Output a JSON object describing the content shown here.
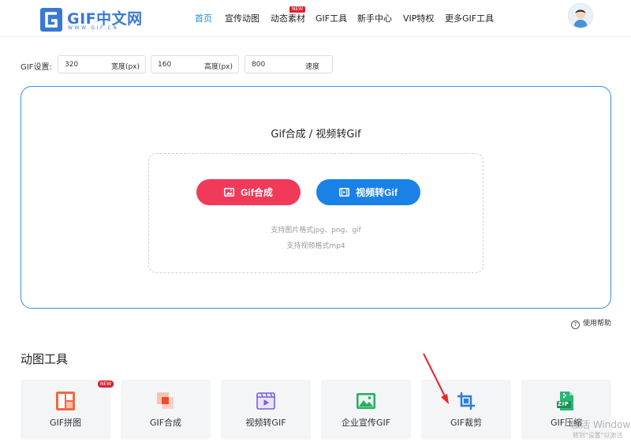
{
  "header": {
    "logo_text": "GIF中文网",
    "logo_sub": "WWW.GIF.CN",
    "nav": [
      "首页",
      "宣传动图",
      "动态素材",
      "GIF工具",
      "新手中心",
      "VIP特权",
      "更多GIF工具"
    ],
    "new_badge": "NEW"
  },
  "settings": {
    "label": "GIF设置:",
    "width_value": "320",
    "width_unit": "宽度(px)",
    "height_value": "160",
    "height_unit": "高度(px)",
    "speed_value": "800",
    "speed_unit": "速度"
  },
  "upload": {
    "title": "Gif合成 / 视频转Gif",
    "gif_button": "Gif合成",
    "video_button": "视频转Gif",
    "hint_images": "支持图片格式jpg、png、gif",
    "hint_video": "支持视频格式mp4"
  },
  "help": {
    "label": "使用帮助"
  },
  "tools": {
    "title": "动图工具",
    "new_badge": "NEW",
    "items": [
      {
        "label": "GIF拼图"
      },
      {
        "label": "GIF合成"
      },
      {
        "label": "视频转GIF"
      },
      {
        "label": "企业宣传GIF"
      },
      {
        "label": "GIF裁剪"
      },
      {
        "label": "GIF压缩"
      }
    ]
  },
  "watermark": {
    "line1": "激活 Windows",
    "line2": "转到\"设置\"以激活"
  },
  "colors": {
    "primary_blue": "#1a82e6",
    "button_red": "#f13a5a",
    "badge_red": "#e21f2f"
  }
}
